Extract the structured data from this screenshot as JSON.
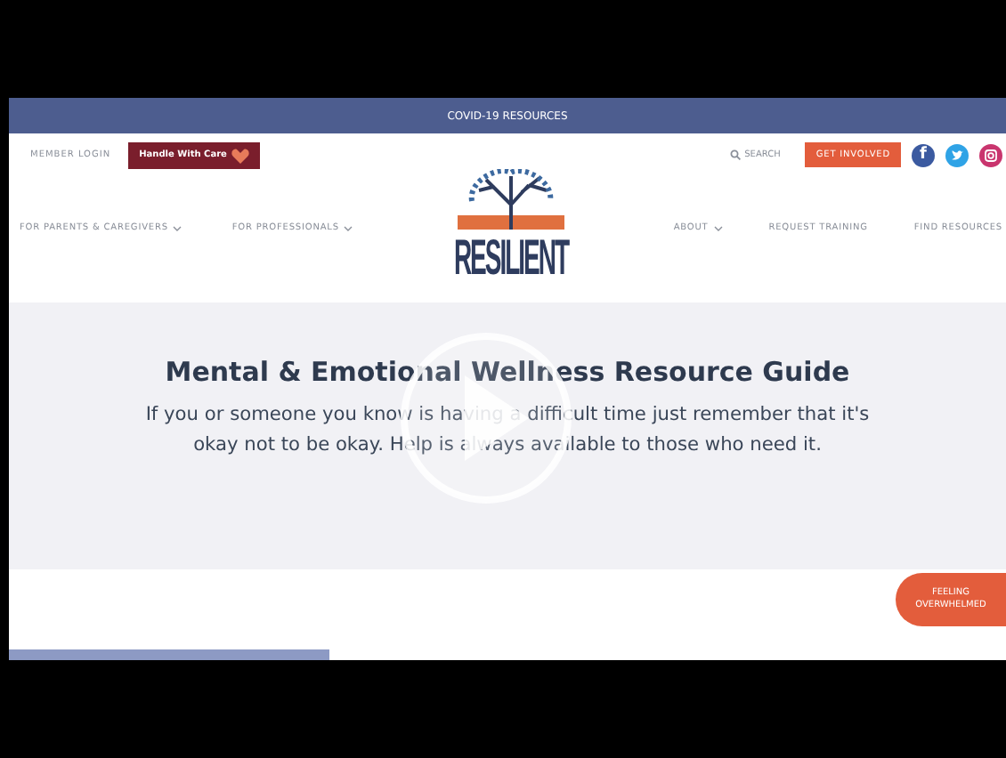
{
  "announcement_bar": {
    "link": "COVID-19 RESOURCES"
  },
  "utility_nav": {
    "member_login": "MEMBER LOGIN",
    "handle_with_care": "Handle With Care",
    "search": "SEARCH",
    "get_involved": "GET INVOLVED",
    "facebook_icon": "f"
  },
  "logo": {
    "wordmark": "RESILIENT"
  },
  "main_nav": [
    {
      "label": "FOR PARENTS & CAREGIVERS",
      "dropdown": true
    },
    {
      "label": "FOR PROFESSIONALS",
      "dropdown": true
    },
    {
      "label": "ABOUT",
      "dropdown": true
    },
    {
      "label": "REQUEST TRAINING",
      "dropdown": false
    },
    {
      "label": "FIND RESOURCES",
      "dropdown": false
    }
  ],
  "hero": {
    "title": "Mental & Emotional Wellness Resource Guide",
    "text": "If you or someone you know is having a difficult time just remember that it's okay not to be okay. Help is always available to those who need it."
  },
  "help_button": "FEELING OVERWHELMED"
}
